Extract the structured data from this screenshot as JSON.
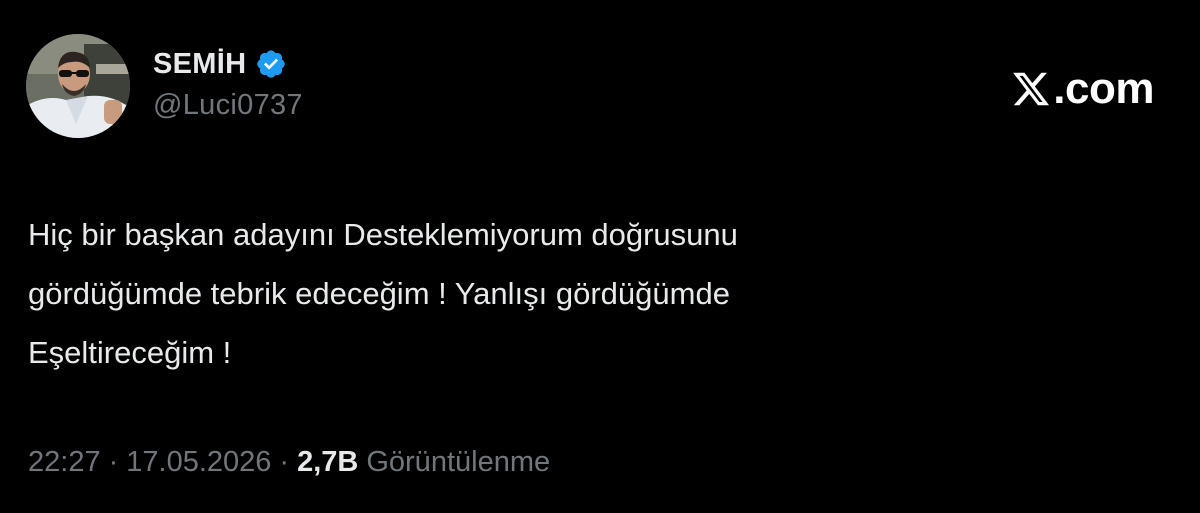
{
  "author": {
    "display_name": "SEMİH",
    "handle": "@Luci0737",
    "verified": true,
    "verified_badge_color": "#1d9bf0"
  },
  "brand": {
    "domain": ".com",
    "logo_icon": "x-logo-icon"
  },
  "tweet": {
    "text": "Hiç bir başkan adayını Desteklemiyorum doğrusunu\ngördüğümde tebrik edeceğim ! Yanlışı gördüğümde\nEşeltireceğim !"
  },
  "meta": {
    "time": "22:27",
    "separator": "·",
    "date": "17.05.2026",
    "views_count": "2,7B",
    "views_label": "Görüntülenme"
  },
  "colors": {
    "background": "#000000",
    "text_primary": "#e7e9ea",
    "text_secondary": "#71767b",
    "accent": "#1d9bf0"
  }
}
